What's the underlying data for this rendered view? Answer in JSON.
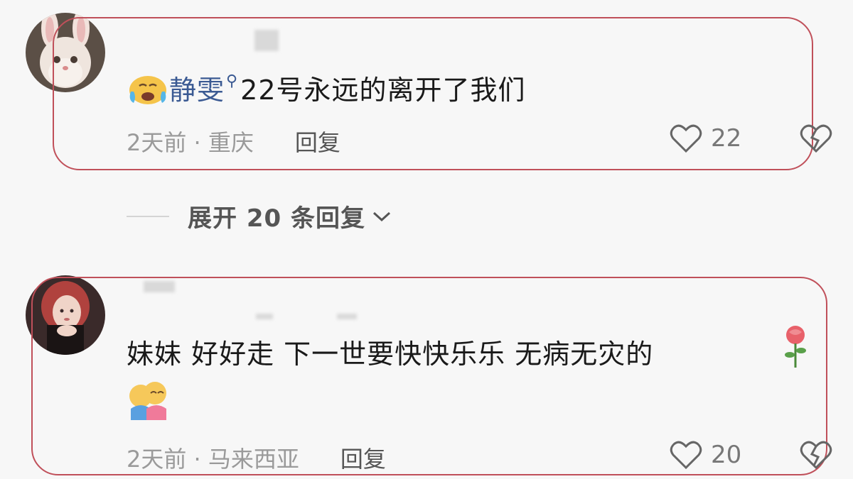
{
  "comments": [
    {
      "avatar_icon": "bunny-cat-avatar",
      "leading_emoji": "crying-face-icon",
      "username": "静雯",
      "text": "22号永远的离开了我们",
      "time_location": "2天前 · 重庆",
      "reply_label": "回复",
      "likes": "22"
    },
    {
      "avatar_icon": "girl-avatar",
      "text": "妹妹  好好走  下一世要快快乐乐 无病无灾的",
      "trailing_emoji": "rose-icon",
      "second_line_emoji": "hugging-face-icon",
      "time_location": "2天前 · 马来西亚",
      "reply_label": "回复",
      "likes": "20"
    }
  ],
  "expand_replies": "展开 20 条回复",
  "colors": {
    "username": "#3b5a93",
    "highlight": "#c0505a",
    "meta": "#9a9a9a"
  }
}
